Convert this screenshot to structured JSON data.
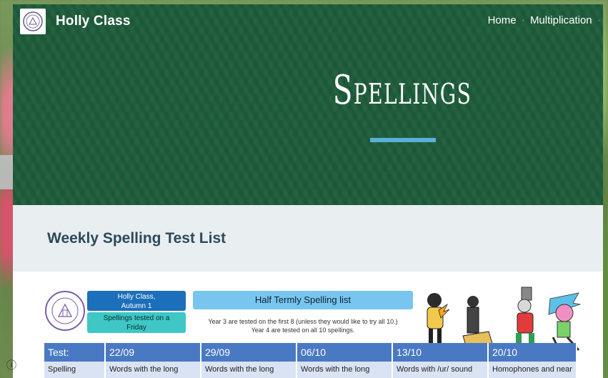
{
  "site": {
    "title": "Holly Class"
  },
  "nav": {
    "items": [
      "Home",
      "Multiplication"
    ]
  },
  "hero": {
    "title": "Spellings"
  },
  "section": {
    "heading": "Weekly Spelling Test List"
  },
  "doc": {
    "class_label_line1": "Holly Class,",
    "class_label_line2": "Autumn 1",
    "tested_line1": "Spellings tested on a",
    "tested_line2": "Friday",
    "halfterm_title": "Half Termly Spelling list",
    "note_line1": "Year 3 are tested on the first 8 (unless they would like to try all 10.)",
    "note_line2": "Year 4 are tested on all 10 spellings.",
    "table": {
      "headers": [
        "Test:",
        "22/09",
        "29/09",
        "06/10",
        "13/10",
        "20/10"
      ],
      "row1": [
        "Spelling",
        "Words with the long",
        "Words with the long",
        "Words with the long",
        "Words with /ur/ sound",
        "Homophones and near"
      ]
    }
  },
  "colors": {
    "header_green": "#1d5c3a",
    "accent_blue": "#5bb0d6",
    "heading_text": "#2d4a5b"
  },
  "icons": {
    "info": "info-icon"
  }
}
